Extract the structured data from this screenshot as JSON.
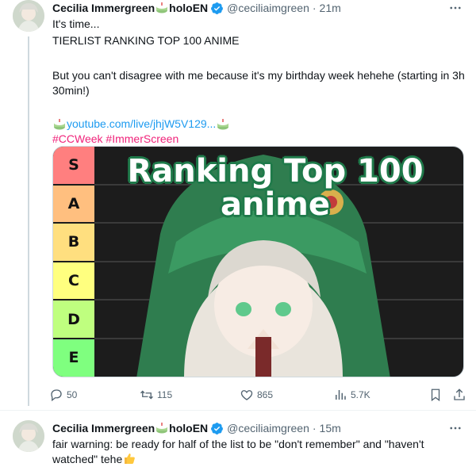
{
  "tweets": [
    {
      "name": "Cecilia Immergreen",
      "name_suffix": "holoEN",
      "handle": "@ceciliaimgreen",
      "separator": "·",
      "time": "21m",
      "lines": {
        "l1": "It's time...",
        "l2": "TIERLIST RANKING TOP 100 ANIME",
        "l3": "But you can't disagree with me because it's my birthday week hehehe (starting in 3h 30min!)",
        "link": "youtube.com/live/jhjW5V129...",
        "hashtags": "#CCWeek #ImmerScreen"
      },
      "media": {
        "title": "Ranking Top 100 anime",
        "tiers": [
          "S",
          "A",
          "B",
          "C",
          "D",
          "E"
        ],
        "tier_colors": [
          "#ff7f7f",
          "#ffbf7f",
          "#ffdf7f",
          "#ffff7f",
          "#bfff7f",
          "#7fff7f"
        ]
      },
      "actions": {
        "replies": "50",
        "reposts": "115",
        "likes": "865",
        "views": "5.7K"
      }
    },
    {
      "name": "Cecilia Immergreen",
      "name_suffix": "holoEN",
      "handle": "@ceciliaimgreen",
      "separator": "·",
      "time": "15m",
      "text": "fair warning: be ready for half of the list to be \"don't remember\" and \"haven't watched\" tehe"
    }
  ],
  "icons": {
    "verified": "verified-badge-icon",
    "cake": "cake-emoji-icon",
    "more": "more-icon",
    "reply": "reply-icon",
    "repost": "repost-icon",
    "like": "like-icon",
    "views": "views-icon",
    "bookmark": "bookmark-icon",
    "share": "share-icon",
    "thumbs": "thumbs-up-emoji-icon"
  },
  "colors": {
    "text": "#0f1419",
    "secondary": "#536471",
    "link": "#1d9bf0",
    "hashtag": "#f0237a",
    "verified": "#1d9bf0"
  }
}
